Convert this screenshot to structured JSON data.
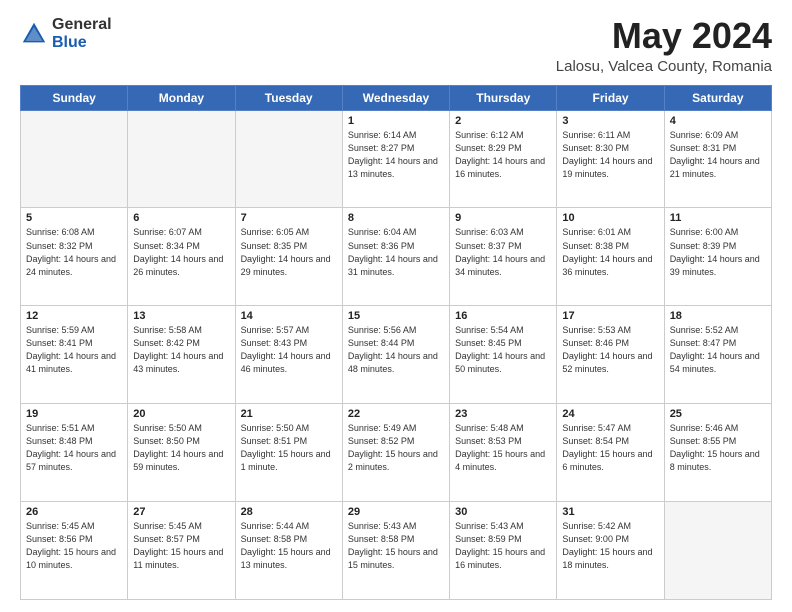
{
  "header": {
    "logo_general": "General",
    "logo_blue": "Blue",
    "title": "May 2024",
    "subtitle": "Lalosu, Valcea County, Romania"
  },
  "days_of_week": [
    "Sunday",
    "Monday",
    "Tuesday",
    "Wednesday",
    "Thursday",
    "Friday",
    "Saturday"
  ],
  "weeks": [
    [
      {
        "day": "",
        "info": ""
      },
      {
        "day": "",
        "info": ""
      },
      {
        "day": "",
        "info": ""
      },
      {
        "day": "1",
        "info": "Sunrise: 6:14 AM\nSunset: 8:27 PM\nDaylight: 14 hours\nand 13 minutes."
      },
      {
        "day": "2",
        "info": "Sunrise: 6:12 AM\nSunset: 8:29 PM\nDaylight: 14 hours\nand 16 minutes."
      },
      {
        "day": "3",
        "info": "Sunrise: 6:11 AM\nSunset: 8:30 PM\nDaylight: 14 hours\nand 19 minutes."
      },
      {
        "day": "4",
        "info": "Sunrise: 6:09 AM\nSunset: 8:31 PM\nDaylight: 14 hours\nand 21 minutes."
      }
    ],
    [
      {
        "day": "5",
        "info": "Sunrise: 6:08 AM\nSunset: 8:32 PM\nDaylight: 14 hours\nand 24 minutes."
      },
      {
        "day": "6",
        "info": "Sunrise: 6:07 AM\nSunset: 8:34 PM\nDaylight: 14 hours\nand 26 minutes."
      },
      {
        "day": "7",
        "info": "Sunrise: 6:05 AM\nSunset: 8:35 PM\nDaylight: 14 hours\nand 29 minutes."
      },
      {
        "day": "8",
        "info": "Sunrise: 6:04 AM\nSunset: 8:36 PM\nDaylight: 14 hours\nand 31 minutes."
      },
      {
        "day": "9",
        "info": "Sunrise: 6:03 AM\nSunset: 8:37 PM\nDaylight: 14 hours\nand 34 minutes."
      },
      {
        "day": "10",
        "info": "Sunrise: 6:01 AM\nSunset: 8:38 PM\nDaylight: 14 hours\nand 36 minutes."
      },
      {
        "day": "11",
        "info": "Sunrise: 6:00 AM\nSunset: 8:39 PM\nDaylight: 14 hours\nand 39 minutes."
      }
    ],
    [
      {
        "day": "12",
        "info": "Sunrise: 5:59 AM\nSunset: 8:41 PM\nDaylight: 14 hours\nand 41 minutes."
      },
      {
        "day": "13",
        "info": "Sunrise: 5:58 AM\nSunset: 8:42 PM\nDaylight: 14 hours\nand 43 minutes."
      },
      {
        "day": "14",
        "info": "Sunrise: 5:57 AM\nSunset: 8:43 PM\nDaylight: 14 hours\nand 46 minutes."
      },
      {
        "day": "15",
        "info": "Sunrise: 5:56 AM\nSunset: 8:44 PM\nDaylight: 14 hours\nand 48 minutes."
      },
      {
        "day": "16",
        "info": "Sunrise: 5:54 AM\nSunset: 8:45 PM\nDaylight: 14 hours\nand 50 minutes."
      },
      {
        "day": "17",
        "info": "Sunrise: 5:53 AM\nSunset: 8:46 PM\nDaylight: 14 hours\nand 52 minutes."
      },
      {
        "day": "18",
        "info": "Sunrise: 5:52 AM\nSunset: 8:47 PM\nDaylight: 14 hours\nand 54 minutes."
      }
    ],
    [
      {
        "day": "19",
        "info": "Sunrise: 5:51 AM\nSunset: 8:48 PM\nDaylight: 14 hours\nand 57 minutes."
      },
      {
        "day": "20",
        "info": "Sunrise: 5:50 AM\nSunset: 8:50 PM\nDaylight: 14 hours\nand 59 minutes."
      },
      {
        "day": "21",
        "info": "Sunrise: 5:50 AM\nSunset: 8:51 PM\nDaylight: 15 hours\nand 1 minute."
      },
      {
        "day": "22",
        "info": "Sunrise: 5:49 AM\nSunset: 8:52 PM\nDaylight: 15 hours\nand 2 minutes."
      },
      {
        "day": "23",
        "info": "Sunrise: 5:48 AM\nSunset: 8:53 PM\nDaylight: 15 hours\nand 4 minutes."
      },
      {
        "day": "24",
        "info": "Sunrise: 5:47 AM\nSunset: 8:54 PM\nDaylight: 15 hours\nand 6 minutes."
      },
      {
        "day": "25",
        "info": "Sunrise: 5:46 AM\nSunset: 8:55 PM\nDaylight: 15 hours\nand 8 minutes."
      }
    ],
    [
      {
        "day": "26",
        "info": "Sunrise: 5:45 AM\nSunset: 8:56 PM\nDaylight: 15 hours\nand 10 minutes."
      },
      {
        "day": "27",
        "info": "Sunrise: 5:45 AM\nSunset: 8:57 PM\nDaylight: 15 hours\nand 11 minutes."
      },
      {
        "day": "28",
        "info": "Sunrise: 5:44 AM\nSunset: 8:58 PM\nDaylight: 15 hours\nand 13 minutes."
      },
      {
        "day": "29",
        "info": "Sunrise: 5:43 AM\nSunset: 8:58 PM\nDaylight: 15 hours\nand 15 minutes."
      },
      {
        "day": "30",
        "info": "Sunrise: 5:43 AM\nSunset: 8:59 PM\nDaylight: 15 hours\nand 16 minutes."
      },
      {
        "day": "31",
        "info": "Sunrise: 5:42 AM\nSunset: 9:00 PM\nDaylight: 15 hours\nand 18 minutes."
      },
      {
        "day": "",
        "info": ""
      }
    ]
  ]
}
